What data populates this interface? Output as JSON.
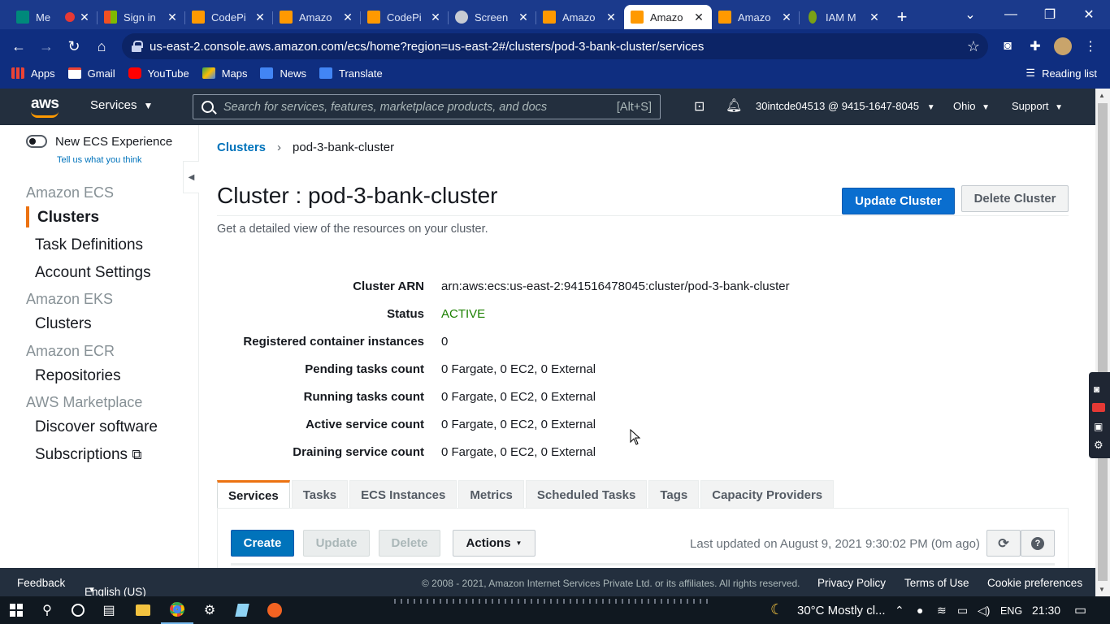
{
  "browser": {
    "tabs": [
      {
        "title": "Me",
        "active": false
      },
      {
        "title": "Sign in",
        "active": false
      },
      {
        "title": "CodePi",
        "active": false
      },
      {
        "title": "Amazo",
        "active": false
      },
      {
        "title": "CodePi",
        "active": false
      },
      {
        "title": "Screen",
        "active": false
      },
      {
        "title": "Amazo",
        "active": false
      },
      {
        "title": "Amazo",
        "active": true
      },
      {
        "title": "Amazo",
        "active": false
      },
      {
        "title": "IAM M",
        "active": false
      }
    ],
    "url": "us-east-2.console.aws.amazon.com/ecs/home?region=us-east-2#/clusters/pod-3-bank-cluster/services",
    "bookmarks": [
      "Apps",
      "Gmail",
      "YouTube",
      "Maps",
      "News",
      "Translate"
    ],
    "reading_list": "Reading list"
  },
  "aws_header": {
    "logo": "aws",
    "services": "Services",
    "search_placeholder": "Search for services, features, marketplace products, and docs",
    "search_shortcut": "[Alt+S]",
    "account": "30intcde04513 @ 9415-1647-8045",
    "region": "Ohio",
    "support": "Support"
  },
  "sidebar": {
    "toggle_label": "New ECS Experience",
    "feedback_link": "Tell us what you think",
    "sections": [
      {
        "title": "Amazon ECS",
        "items": [
          "Clusters",
          "Task Definitions",
          "Account Settings"
        ]
      },
      {
        "title": "Amazon EKS",
        "items": [
          "Clusters"
        ]
      },
      {
        "title": "Amazon ECR",
        "items": [
          "Repositories"
        ]
      },
      {
        "title": "AWS Marketplace",
        "items": [
          "Discover software",
          "Subscriptions"
        ]
      }
    ]
  },
  "breadcrumb": {
    "root": "Clusters",
    "current": "pod-3-bank-cluster"
  },
  "page": {
    "title": "Cluster : pod-3-bank-cluster",
    "subtitle": "Get a detailed view of the resources on your cluster.",
    "update_button": "Update Cluster",
    "delete_button": "Delete Cluster"
  },
  "details": [
    {
      "key": "Cluster ARN",
      "value": "arn:aws:ecs:us-east-2:941516478045:cluster/pod-3-bank-cluster"
    },
    {
      "key": "Status",
      "value": "ACTIVE"
    },
    {
      "key": "Registered container instances",
      "value": "0"
    },
    {
      "key": "Pending tasks count",
      "value": "0 Fargate, 0 EC2, 0 External"
    },
    {
      "key": "Running tasks count",
      "value": "0 Fargate, 0 EC2, 0 External"
    },
    {
      "key": "Active service count",
      "value": "0 Fargate, 0 EC2, 0 External"
    },
    {
      "key": "Draining service count",
      "value": "0 Fargate, 0 EC2, 0 External"
    }
  ],
  "tabs": [
    "Services",
    "Tasks",
    "ECS Instances",
    "Metrics",
    "Scheduled Tasks",
    "Tags",
    "Capacity Providers"
  ],
  "toolbar": {
    "create": "Create",
    "update": "Update",
    "delete": "Delete",
    "actions": "Actions",
    "last_updated": "Last updated on August 9, 2021 9:30:02 PM (0m ago)"
  },
  "footer": {
    "feedback": "Feedback",
    "language": "English (US)",
    "copyright": "© 2008 - 2021, Amazon Internet Services Private Ltd. or its affiliates. All rights reserved.",
    "privacy": "Privacy Policy",
    "terms": "Terms of Use",
    "cookies": "Cookie preferences"
  },
  "taskbar": {
    "weather": "30°C  Mostly cl...",
    "lang": "ENG",
    "time": "21:30"
  },
  "colors": {
    "accent": "#ec7211",
    "primary": "#0a6ecf",
    "aws_bar": "#232f3e",
    "chrome": "#1b3a8c",
    "active": "#1d8102"
  }
}
